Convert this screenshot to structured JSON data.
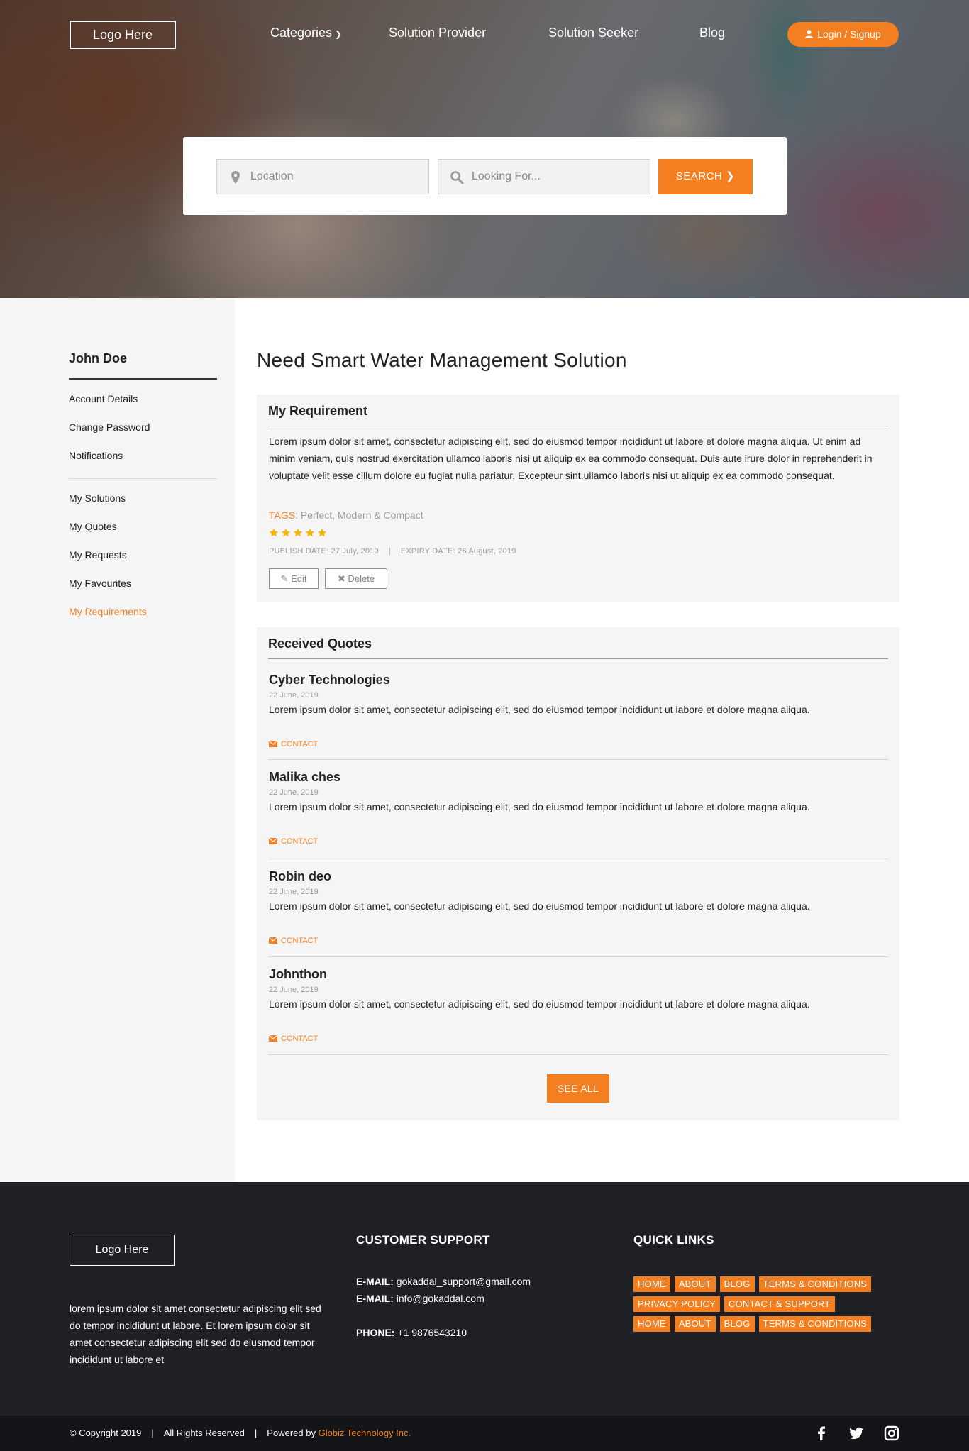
{
  "header": {
    "logo": "Logo Here",
    "nav": {
      "categories": "Categories",
      "solution_provider": "Solution Provider",
      "solution_seeker": "Solution Seeker",
      "blog": "Blog"
    },
    "login": "Login / Signup"
  },
  "search": {
    "location_placeholder": "Location",
    "looking_placeholder": "Looking For...",
    "button": "SEARCH"
  },
  "sidebar": {
    "user_name": "John Doe",
    "account_items": [
      "Account Details",
      "Change Password",
      "Notifications"
    ],
    "activity_items": [
      "My Solutions",
      "My Quotes",
      "My Requests",
      "My Favourites",
      "My Requirements"
    ],
    "active_item": "My Requirements"
  },
  "page_title": "Need Smart Water Management Solution",
  "requirement": {
    "heading": "My Requirement",
    "description": "Lorem ipsum dolor sit amet, consectetur adipiscing elit, sed do eiusmod tempor incididunt ut labore et dolore magna aliqua. Ut enim ad minim veniam, quis nostrud exercitation ullamco laboris nisi ut aliquip ex ea commodo consequat. Duis aute irure dolor in reprehenderit in voluptate velit esse cillum dolore eu fugiat nulla pariatur. Excepteur sint.ullamco laboris nisi ut aliquip ex ea commodo consequat.",
    "tags_label": "TAGS:",
    "tags_value": "Perfect, Modern & Compact",
    "rating": 5,
    "rating_max": 5,
    "publish_date": "PUBLISH DATE: 27 July, 2019",
    "date_separator": "|",
    "expiry_date": "EXPIRY DATE: 26 August, 2019",
    "edit_label": "Edit",
    "delete_label": "Delete"
  },
  "quotes": {
    "heading": "Received Quotes",
    "items": [
      {
        "name": "Cyber Technologies",
        "date": "22 June, 2019",
        "text": "Lorem ipsum dolor sit amet, consectetur adipiscing elit, sed do eiusmod tempor incididunt ut labore et dolore magna aliqua.",
        "contact": "CONTACT"
      },
      {
        "name": "Malika ches",
        "date": "22 June, 2019",
        "text": "Lorem ipsum dolor sit amet, consectetur adipiscing elit, sed do eiusmod tempor incididunt ut labore et dolore magna aliqua.",
        "contact": "CONTACT"
      },
      {
        "name": "Robin deo",
        "date": "22 June, 2019",
        "text": "Lorem ipsum dolor sit amet, consectetur adipiscing elit, sed do eiusmod tempor incididunt ut labore et dolore magna aliqua.",
        "contact": "CONTACT"
      },
      {
        "name": "Johnthon",
        "date": "22 June, 2019",
        "text": "Lorem ipsum dolor sit amet, consectetur adipiscing elit, sed do eiusmod tempor incididunt ut labore et dolore magna aliqua.",
        "contact": "CONTACT"
      }
    ],
    "see_all": "SEE ALL"
  },
  "footer": {
    "logo": "Logo Here",
    "about": "lorem ipsum dolor sit amet consectetur adipiscing elit sed do tempor incididunt ut labore.  Et lorem ipsum dolor sit amet consectetur adipiscing elit sed do eiusmod tempor incididunt ut labore et",
    "support_heading": "CUSTOMER SUPPORT",
    "email_label": "E-MAIL:",
    "email_1": "gokaddal_support@gmail.com",
    "email_2": "info@gokaddal.com",
    "phone_label": "PHONE:",
    "phone": "+1 9876543210",
    "quick_heading": "QUICK LINKS",
    "quick_links": [
      [
        "HOME",
        "ABOUT",
        "BLOG",
        "TERMS & CONDITIONS"
      ],
      [
        "PRIVACY POLICY",
        "CONTACT & SUPPORT"
      ],
      [
        "HOME",
        "ABOUT",
        "BLOG",
        "TERMS & CONDITIONS"
      ]
    ],
    "copyright": "© Copyright 2019",
    "separator": "|",
    "rights": "All Rights Reserved",
    "powered_by": "Powered by",
    "company": "Globiz Technology Inc.",
    "social": [
      "facebook-icon",
      "twitter-icon",
      "instagram-icon"
    ]
  },
  "colors": {
    "accent": "#f47f20",
    "footer_bg": "#1f2025",
    "panel_bg": "#f5f5f5"
  }
}
